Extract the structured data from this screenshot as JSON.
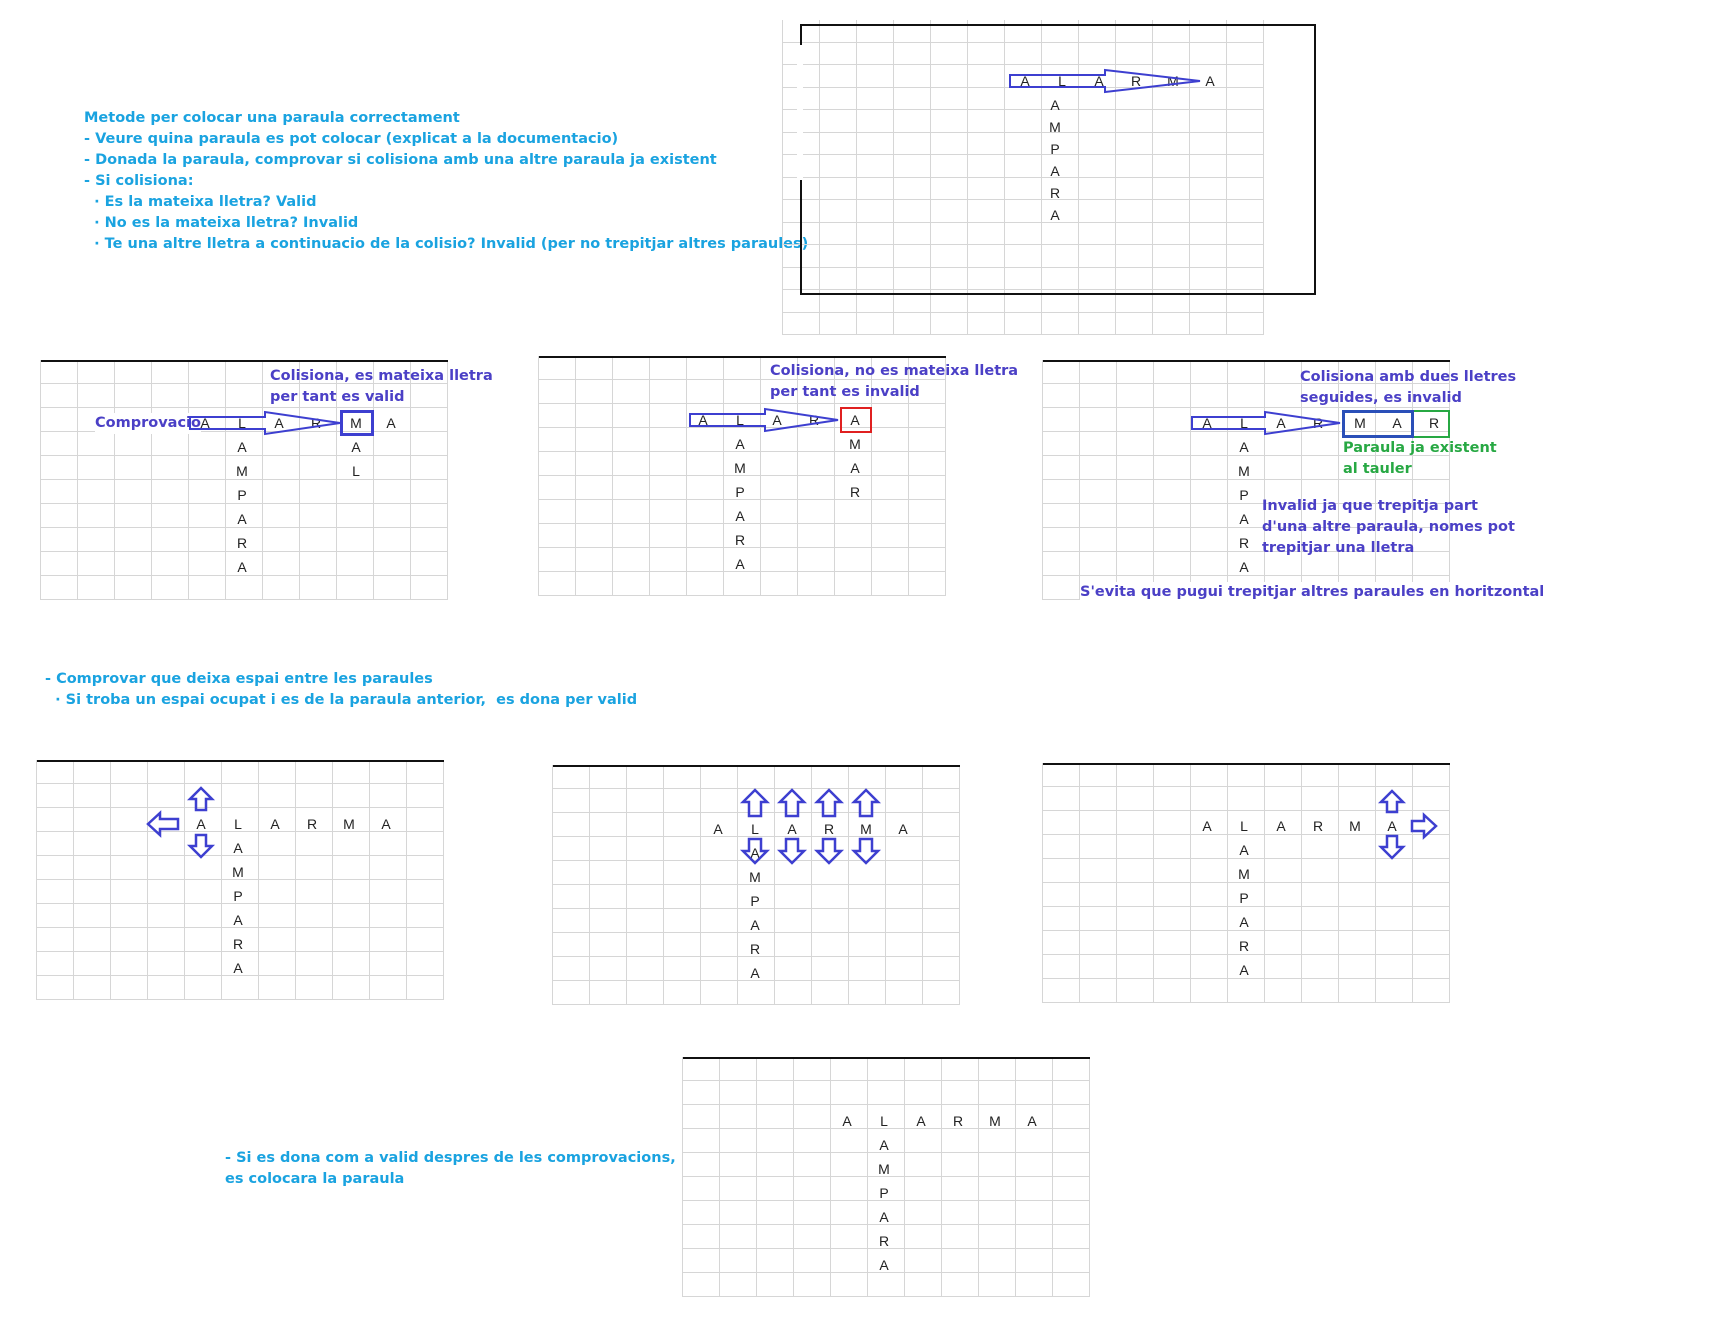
{
  "intro": {
    "title": "Metode per colocar una paraula correctament",
    "steps": [
      "- Veure quina paraula es pot colocar (explicat a la documentacio)",
      "- Donada la paraula, comprovar si colisiona amb una altre paraula ja existent",
      "- Si colisiona:",
      "  · Es la mateixa lletra? Valid",
      "  · No es la mateixa lletra? Invalid",
      "  · Te una altre lletra a continuacio de la colisio? Invalid (per no trepitjar altres paraules)"
    ]
  },
  "words": {
    "horizontal": [
      "A",
      "L",
      "A",
      "R",
      "M",
      "A"
    ],
    "vertical": [
      "A",
      "M",
      "P",
      "A",
      "R",
      "A"
    ],
    "mal": [
      "M",
      "A",
      "L"
    ],
    "mar": [
      "M",
      "A",
      "R"
    ]
  },
  "case1": {
    "note_line1": "Colisiona, es mateixa lletra",
    "note_line2": "per tant es valid",
    "label": "Comprovacio"
  },
  "case2": {
    "note_line1": "Colisiona, no es mateixa lletra",
    "note_line2": "per tant es invalid"
  },
  "case3": {
    "note_line1": "Colisiona amb dues lletres",
    "note_line2": "seguides, es invalid",
    "existing_line1": "Paraula ja existent",
    "existing_line2": "al tauler",
    "invalid_line1": "Invalid ja que trepitja part",
    "invalid_line2": "d'una altre paraula, nomes pot",
    "invalid_line3": "trepitjar una lletra",
    "footer": "S'evita que pugui trepitjar altres paraules en horitzontal"
  },
  "spacing": {
    "line1": "- Comprovar que deixa espai entre les paraules",
    "line2": "  · Si troba un espai ocupat i es de la paraula anterior,  es dona per valid"
  },
  "final": {
    "line1": "- Si es dona com a valid despres de les comprovacions,",
    "line2": "es colocara la paraula"
  },
  "colors": {
    "arrow": "#3d3fd0",
    "valid_box": "#3d3fd0",
    "invalid_box": "#e02020",
    "existing_box": "#27a843",
    "note_text": "#4b40c6",
    "intro_text": "#1aa3e0"
  }
}
